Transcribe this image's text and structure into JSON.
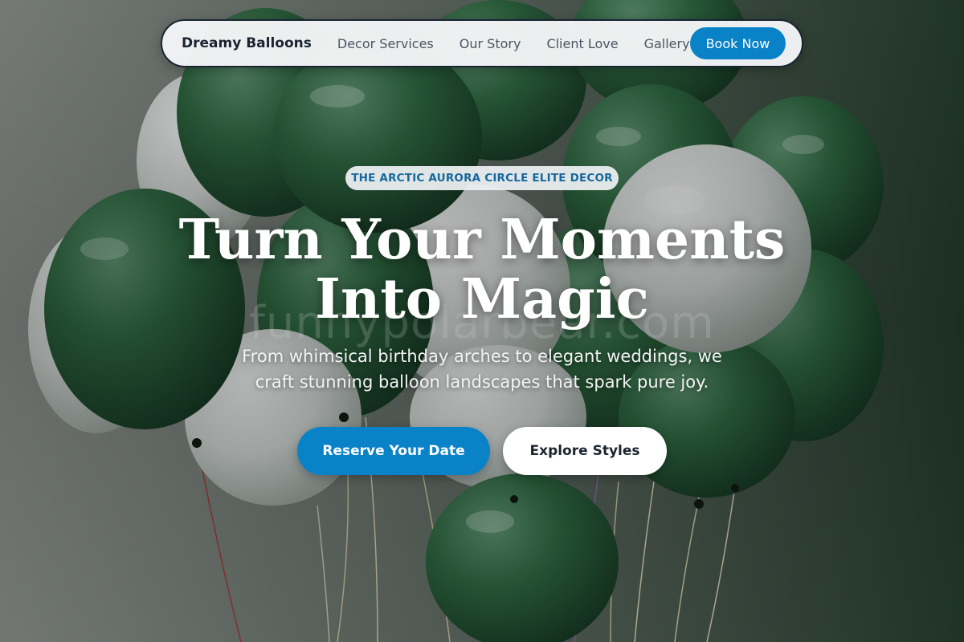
{
  "nav": {
    "brand": "Dreamy Balloons",
    "links": [
      {
        "label": "Decor Services"
      },
      {
        "label": "Our Story"
      },
      {
        "label": "Client Love"
      },
      {
        "label": "Gallery"
      }
    ],
    "cta_label": "Book Now"
  },
  "hero": {
    "eyebrow": "THE ARCTIC AURORA CIRCLE ELITE DECOR",
    "headline_line1": "Turn Your Moments",
    "headline_line2": "Into Magic",
    "subtext_line1": "From whimsical birthday arches to elegant weddings, we",
    "subtext_line2": "craft stunning balloon landscapes that spark pure joy.",
    "primary_cta": "Reserve Your Date",
    "secondary_cta": "Explore Styles",
    "watermark": "funnypolarbear.com",
    "background_image": "green-and-white-balloon-bouquet"
  },
  "colors": {
    "accent": "#0a82c8",
    "eyebrow_text": "#16689e",
    "brand_text": "#1b2430",
    "balloon_green": "#2f6a42",
    "balloon_white": "#d9dedb"
  }
}
